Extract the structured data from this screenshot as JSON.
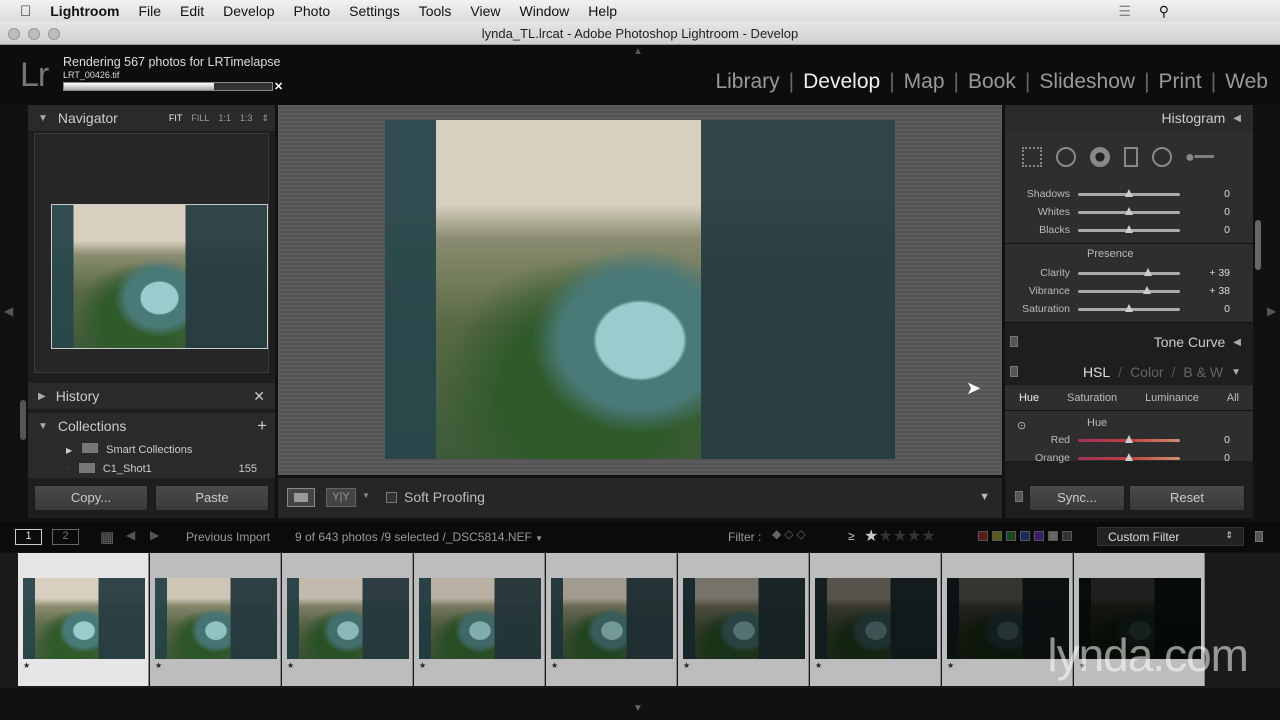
{
  "menubar": {
    "app": "Lightroom",
    "items": [
      "File",
      "Edit",
      "Develop",
      "Photo",
      "Settings",
      "Tools",
      "View",
      "Window",
      "Help"
    ]
  },
  "window": {
    "title": "lynda_TL.lrcat - Adobe Photoshop Lightroom - Develop"
  },
  "identity": {
    "logo": "Lr",
    "render_title": "Rendering 567 photos for LRTimelapse",
    "render_file": "LRT_00426.tif",
    "progress_percent": 72
  },
  "modules": [
    "Library",
    "Develop",
    "Map",
    "Book",
    "Slideshow",
    "Print",
    "Web"
  ],
  "active_module": "Develop",
  "left": {
    "navigator": "Navigator",
    "nav_options": [
      "FIT",
      "FILL",
      "1:1",
      "1:3"
    ],
    "history": "History",
    "collections": "Collections",
    "collection_items": [
      {
        "name": "Smart Collections",
        "count": ""
      },
      {
        "name": "C1_Shot1",
        "count": "155"
      }
    ],
    "copy": "Copy...",
    "paste": "Paste"
  },
  "right": {
    "histogram": "Histogram",
    "basic_sliders": [
      {
        "label": "Shadows",
        "value": "0",
        "pos": 0.5
      },
      {
        "label": "Whites",
        "value": "0",
        "pos": 0.5
      },
      {
        "label": "Blacks",
        "value": "0",
        "pos": 0.5
      }
    ],
    "presence": "Presence",
    "presence_sliders": [
      {
        "label": "Clarity",
        "value": "+ 39",
        "pos": 0.69
      },
      {
        "label": "Vibrance",
        "value": "+ 38",
        "pos": 0.68
      },
      {
        "label": "Saturation",
        "value": "0",
        "pos": 0.5
      }
    ],
    "tone_curve": "Tone Curve",
    "hsl": "HSL",
    "color": "Color",
    "bw": "B & W",
    "hsl_tabs": [
      "Hue",
      "Saturation",
      "Luminance",
      "All"
    ],
    "hue_title": "Hue",
    "hue_sliders": [
      {
        "label": "Red",
        "value": "0",
        "pos": 0.5
      },
      {
        "label": "Orange",
        "value": "0",
        "pos": 0.5
      }
    ],
    "sync": "Sync...",
    "reset": "Reset"
  },
  "toolbar": {
    "soft_proofing": "Soft Proofing",
    "yy": "Y|Y"
  },
  "filmstrip": {
    "screen1": "1",
    "screen2": "2",
    "source": "Previous Import",
    "info": "9 of 643 photos /9 selected /_DSC5814.NEF",
    "filter_label": "Filter :",
    "rating_op": "≥",
    "custom_filter": "Custom Filter",
    "thumb_brightness": [
      1,
      0.95,
      0.9,
      0.85,
      0.75,
      0.55,
      0.4,
      0.25,
      0.15
    ]
  },
  "watermark": "lynda.com"
}
